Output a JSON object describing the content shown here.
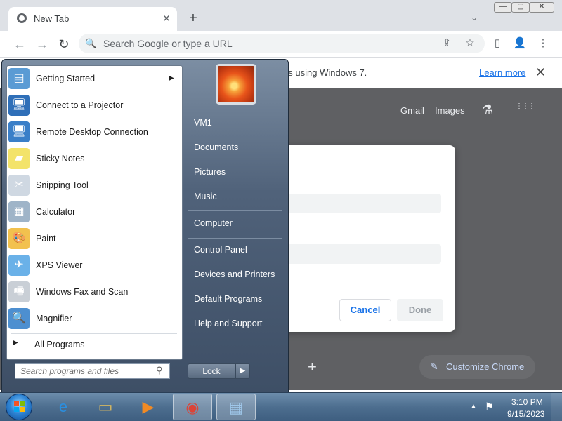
{
  "chrome": {
    "tab_title": "New Tab",
    "tab_close": "✕",
    "new_tab": "+",
    "tab_search": "⌄",
    "win_min": "—",
    "win_max": "▢",
    "win_close": "✕",
    "back": "←",
    "forward": "→",
    "reload": "↻",
    "omnibox_placeholder": "Search Google or type a URL",
    "search_glyph": "🔍",
    "share_glyph": "⇪",
    "star_glyph": "☆",
    "sidepanel_glyph": "▯",
    "profile_glyph": "👤",
    "menu_glyph": "⋮",
    "infobar_text": "ter. This computer is using Windows 7.",
    "learn_more": "Learn more",
    "infobar_close": "✕",
    "ntp": {
      "gmail": "Gmail",
      "images": "Images",
      "labs_glyph": "⚗",
      "apps_glyph": "⋮⋮⋮",
      "plus": "+",
      "customize": "Customize Chrome",
      "customize_glyph": "✎"
    },
    "dialog": {
      "cancel": "Cancel",
      "done": "Done"
    }
  },
  "start_menu": {
    "programs": [
      {
        "label": "Getting Started",
        "icon": "getting-started-icon",
        "color": "#5a9bd4",
        "glyph": "▤"
      },
      {
        "label": "Connect to a Projector",
        "icon": "projector-icon",
        "color": "#2f6fb8",
        "glyph": "🖥"
      },
      {
        "label": "Remote Desktop Connection",
        "icon": "remote-desktop-icon",
        "color": "#3a7fc8",
        "glyph": "🖥"
      },
      {
        "label": "Sticky Notes",
        "icon": "sticky-notes-icon",
        "color": "#f3e36a",
        "glyph": "▰"
      },
      {
        "label": "Snipping Tool",
        "icon": "snipping-tool-icon",
        "color": "#cfd8e2",
        "glyph": "✂"
      },
      {
        "label": "Calculator",
        "icon": "calculator-icon",
        "color": "#9fb4c8",
        "glyph": "▦"
      },
      {
        "label": "Paint",
        "icon": "paint-icon",
        "color": "#f2c14e",
        "glyph": "🎨"
      },
      {
        "label": "XPS Viewer",
        "icon": "xps-viewer-icon",
        "color": "#6ab1e8",
        "glyph": "✈"
      },
      {
        "label": "Windows Fax and Scan",
        "icon": "fax-scan-icon",
        "color": "#c9cfd6",
        "glyph": "🖷"
      },
      {
        "label": "Magnifier",
        "icon": "magnifier-icon",
        "color": "#4d8fd0",
        "glyph": "🔍"
      }
    ],
    "getting_started_arrow": "▶",
    "all_programs_arrow": "▶",
    "all_programs": "All Programs",
    "search_placeholder": "Search programs and files",
    "search_glyph": "⚲",
    "right_links": [
      "VM1",
      "Documents",
      "Pictures",
      "Music",
      "Computer",
      "Control Panel",
      "Devices and Printers",
      "Default Programs",
      "Help and Support"
    ],
    "lock": "Lock",
    "lock_arrow": "▶"
  },
  "taskbar": {
    "apps": [
      {
        "name": "ie-icon",
        "glyph": "e",
        "color": "#2a8fe0"
      },
      {
        "name": "explorer-icon",
        "glyph": "▭",
        "color": "#e8c15a"
      },
      {
        "name": "media-player-icon",
        "glyph": "▶",
        "color": "#f08a24"
      },
      {
        "name": "chrome-icon",
        "glyph": "◉",
        "color": "#db4437"
      },
      {
        "name": "control-panel-icon",
        "glyph": "▦",
        "color": "#9fc7ea"
      }
    ],
    "tray_up": "▲",
    "tray_flag": "⚑",
    "time": "3:10 PM",
    "date": "9/15/2023"
  }
}
